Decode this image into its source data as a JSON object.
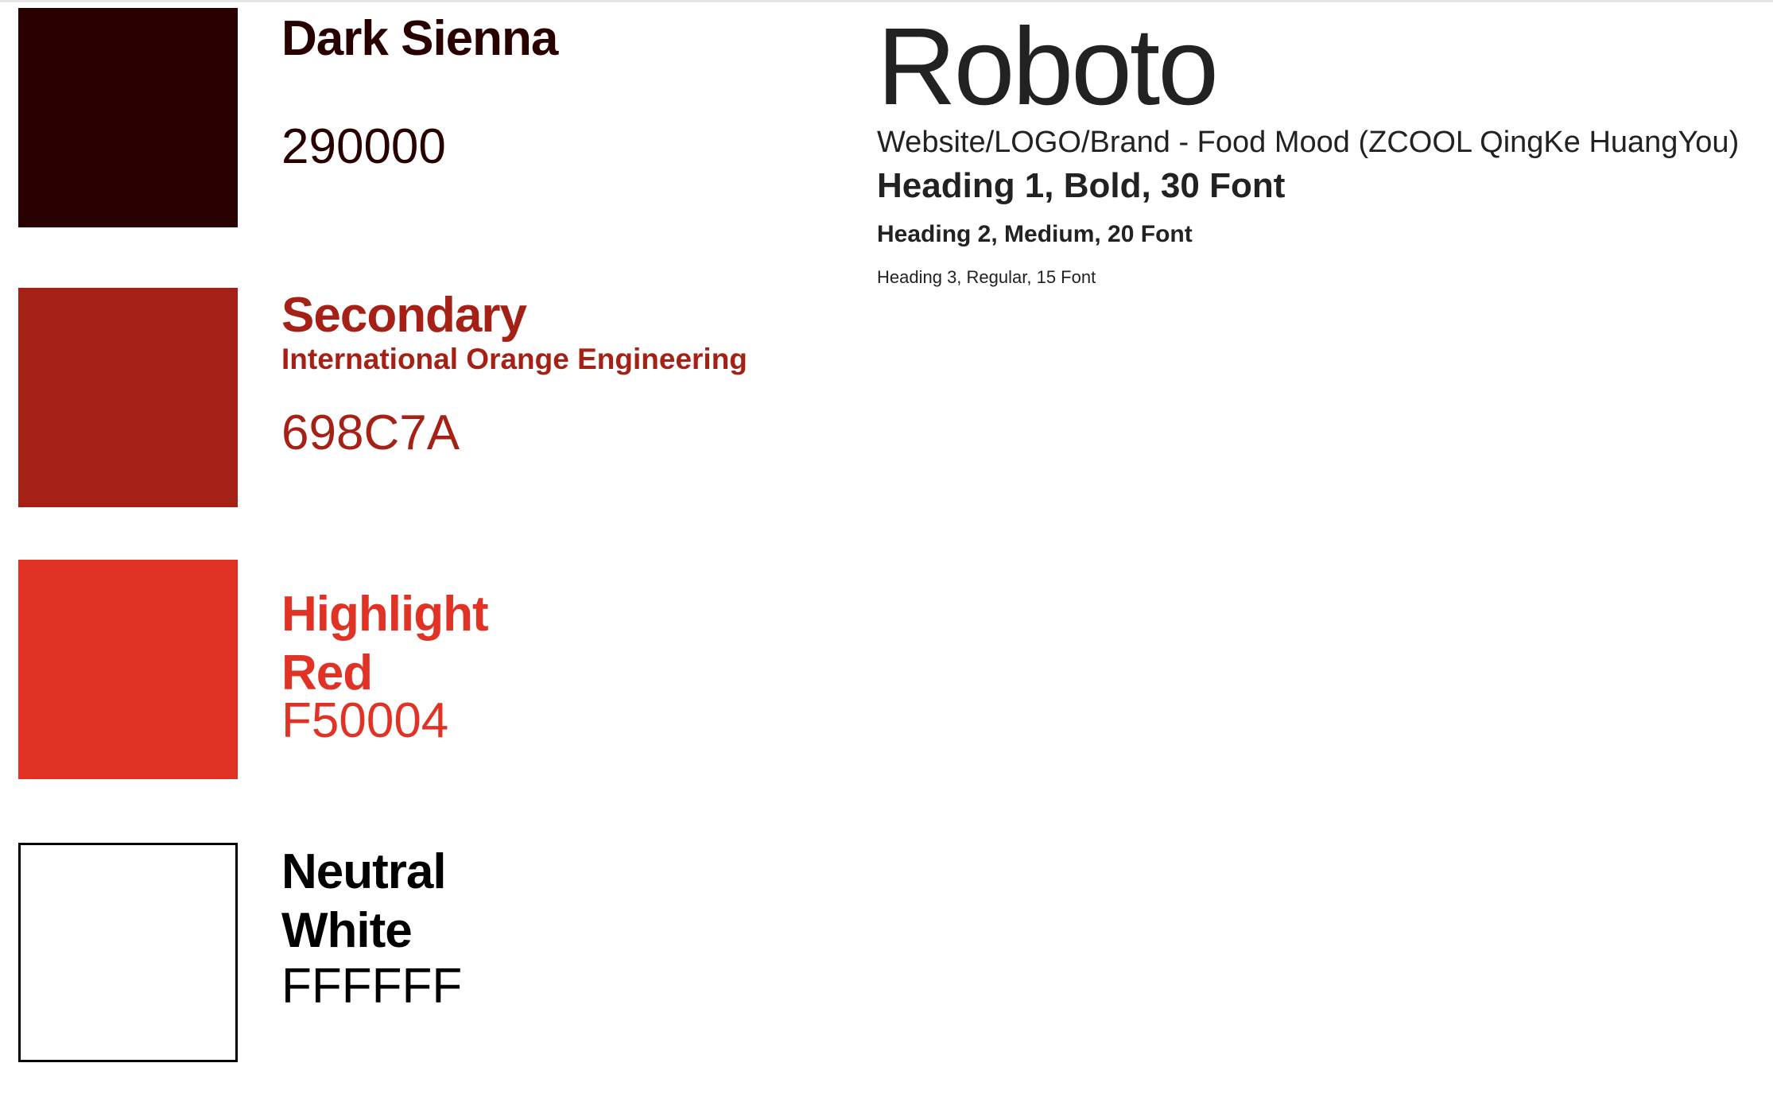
{
  "colors": {
    "dark_sienna": "#290000",
    "secondary": "#A52116",
    "highlight": "#E13226",
    "neutral": "#FFFFFF",
    "border": "#000000",
    "text_dark": "#222222"
  },
  "palette": [
    {
      "name": "Dark Sienna",
      "hex": "290000"
    },
    {
      "name": "Secondary",
      "subtitle": "International Orange Engineering",
      "hex": "698C7A"
    },
    {
      "name_line1": "Highlight",
      "name_line2": "Red",
      "hex": "F50004"
    },
    {
      "name_line1": "Neutral",
      "name_line2": "White",
      "hex": "FFFFFF"
    }
  ],
  "typography": {
    "font_name": "Roboto",
    "brand_line": "Website/LOGO/Brand - Food Mood (ZCOOL QingKe HuangYou)",
    "heading1": "Heading 1, Bold, 30 Font",
    "heading2": "Heading 2, Medium, 20 Font",
    "heading3": "Heading 3, Regular, 15 Font"
  }
}
